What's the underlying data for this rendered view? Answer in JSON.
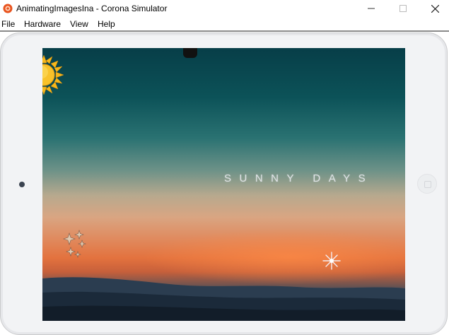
{
  "window": {
    "title": "AnimatingImagesIna - Corona Simulator",
    "minimize_glyph": "—",
    "maximize_glyph": "☐",
    "close_glyph": "✕"
  },
  "menu": {
    "file": "File",
    "hardware": "Hardware",
    "view": "View",
    "help": "Help"
  },
  "screen": {
    "text": "SUNNY DAYS",
    "icons": [
      "sun-icon",
      "sparkles-icon",
      "star-icon"
    ]
  },
  "colors": {
    "app_icon": "#e8531e",
    "sun": "#f7b81a",
    "sky_top": "#073e48",
    "sunset": "#e3723e"
  }
}
